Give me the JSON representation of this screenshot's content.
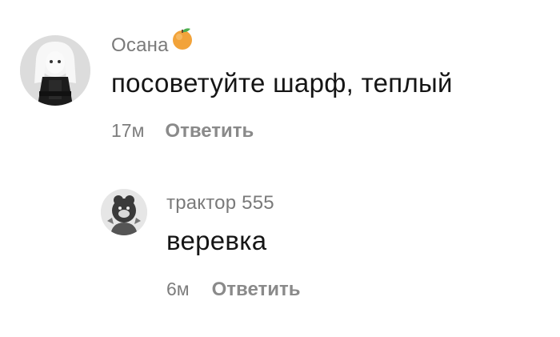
{
  "comments": [
    {
      "author": "Осана",
      "author_badge_icon": "orange-fruit-icon",
      "text": "посоветуйте шарф, теплый",
      "time": "17м",
      "reply_label": "Ответить"
    }
  ],
  "reply": {
    "author": "трактор 555",
    "text": "веревка",
    "time": "6м",
    "reply_label": "Ответить"
  },
  "colors": {
    "author": "#7a7a7a",
    "text": "#151515",
    "time": "#7d7d7d",
    "reply_action": "#8a8a8a",
    "badge_orange": "#f0a030"
  }
}
